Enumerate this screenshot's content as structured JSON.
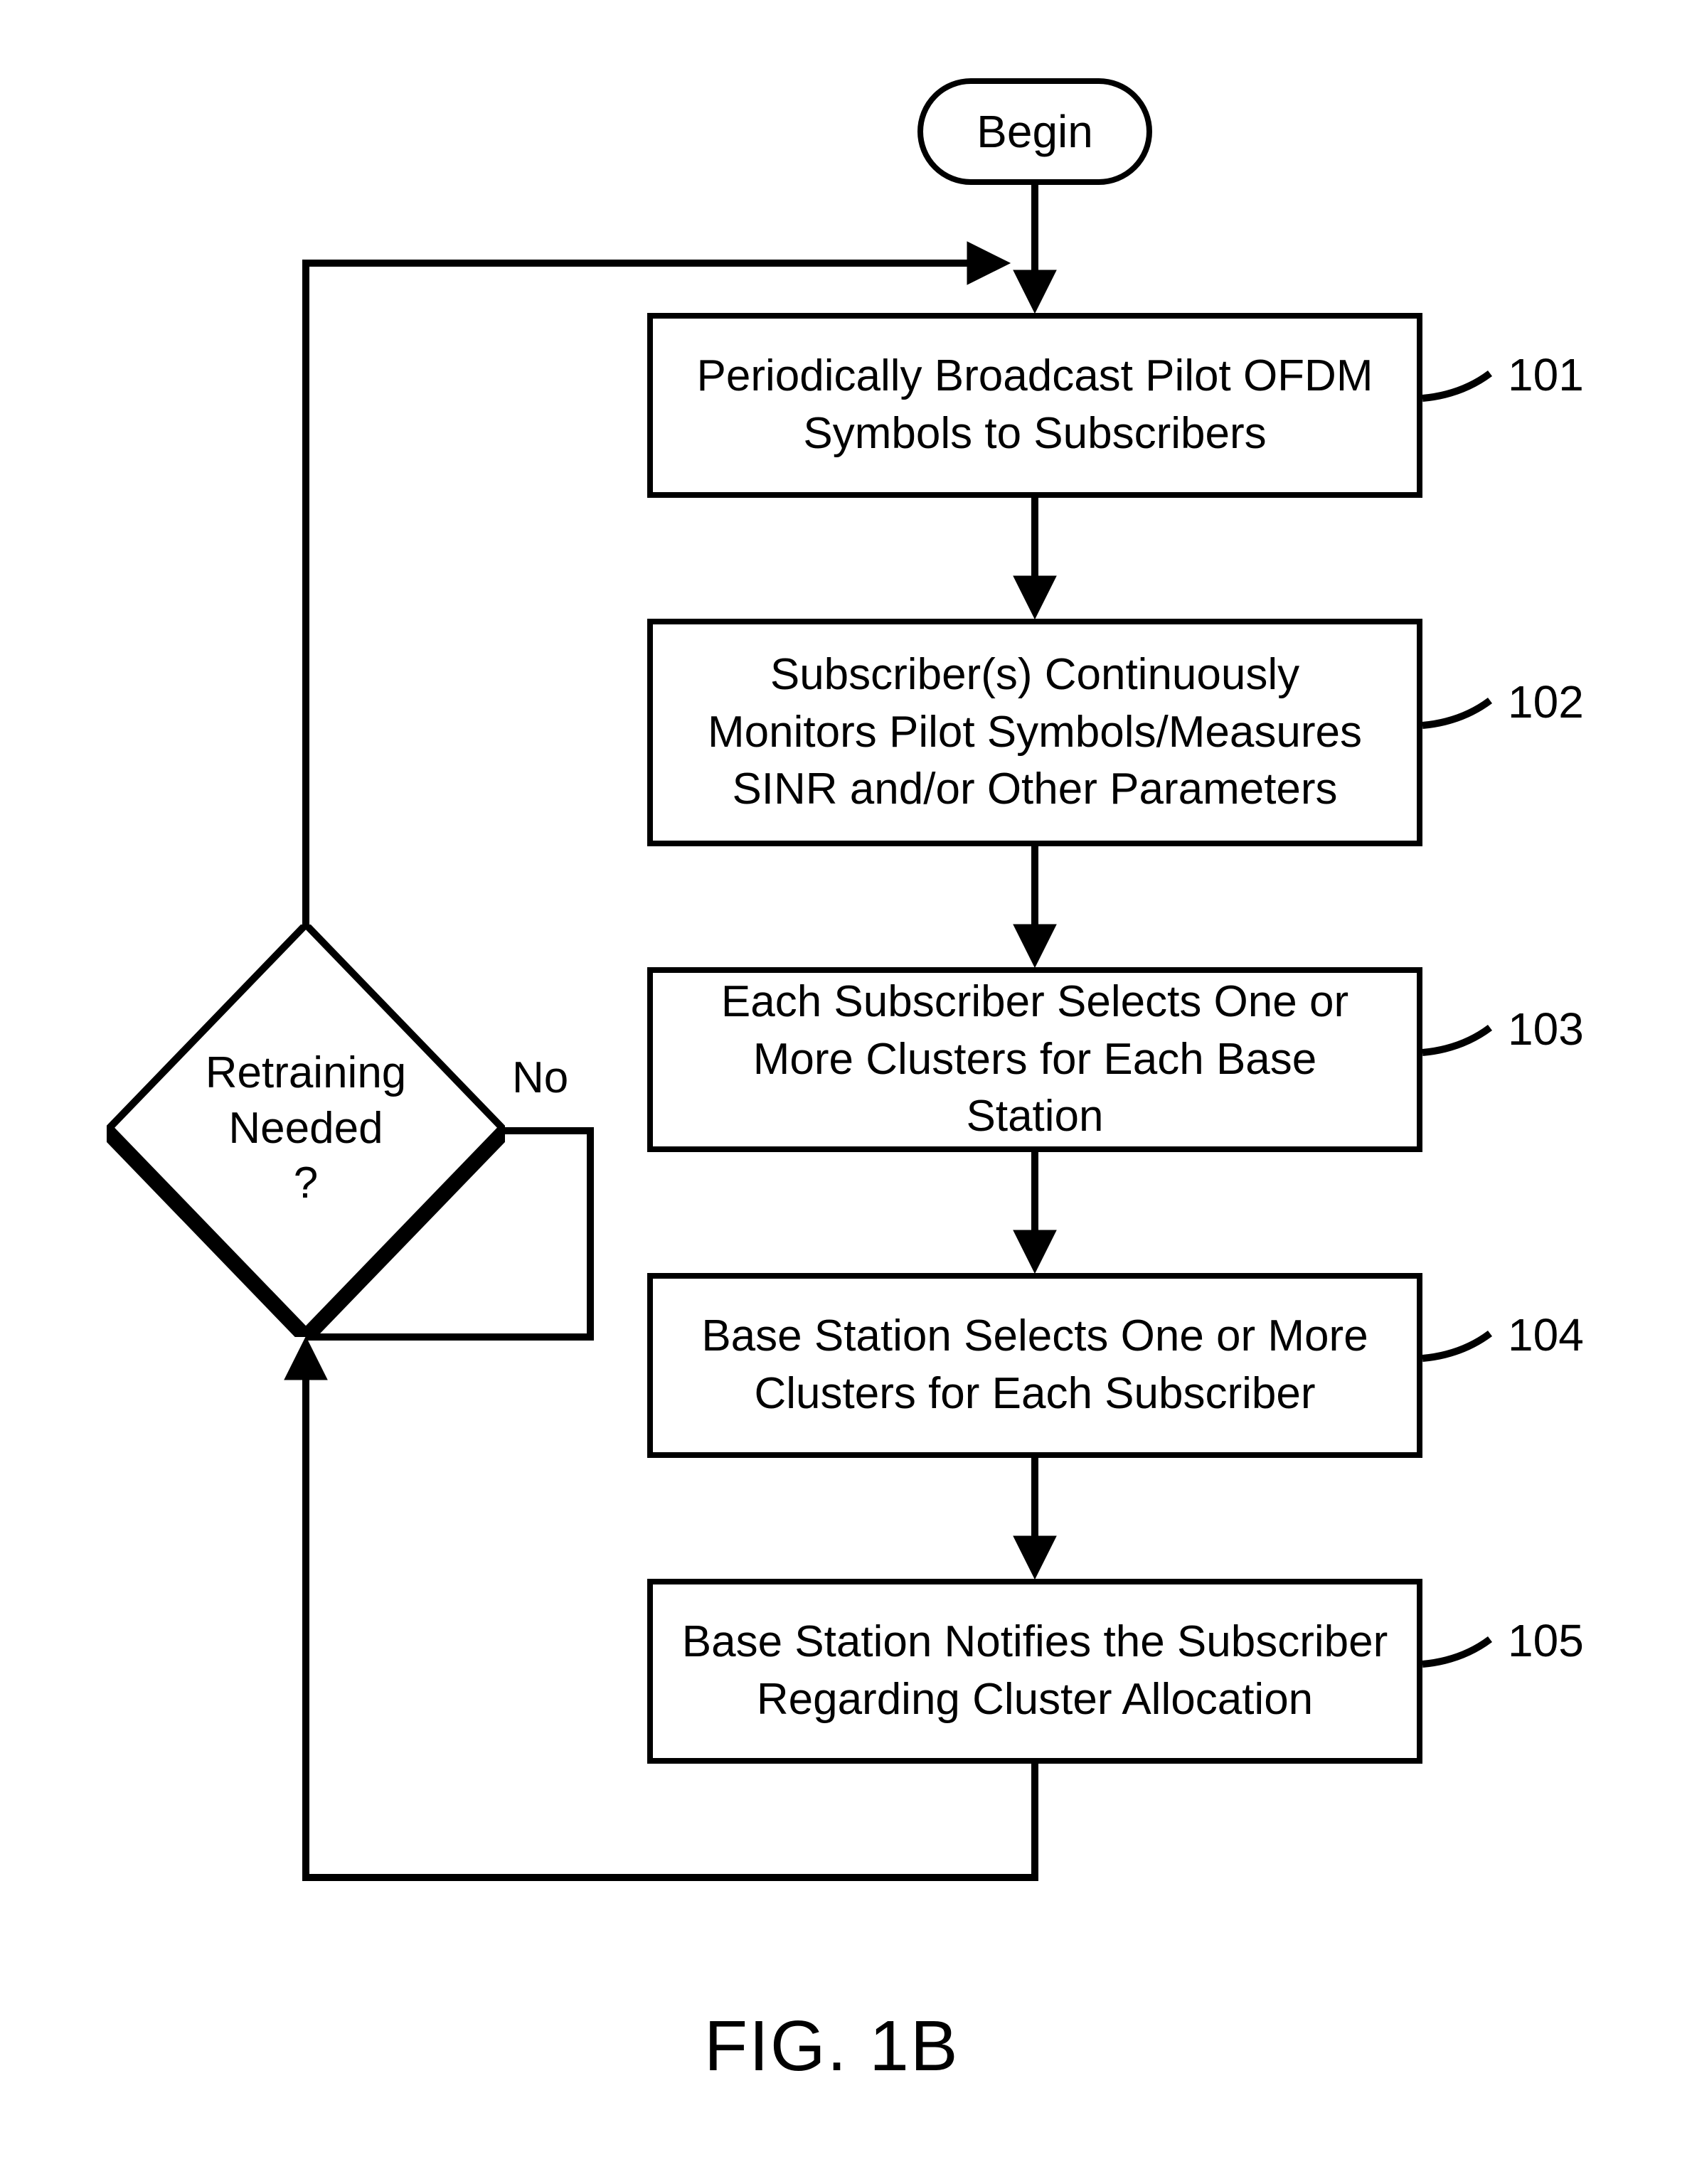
{
  "terminator": {
    "begin": "Begin"
  },
  "steps": {
    "s101": {
      "text": "Periodically Broadcast Pilot OFDM Symbols to Subscribers",
      "ref": "101"
    },
    "s102": {
      "text": "Subscriber(s) Continuously Monitors Pilot Symbols/Measures SINR and/or Other Parameters",
      "ref": "102"
    },
    "s103": {
      "text": "Each Subscriber Selects One or More Clusters for Each Base Station",
      "ref": "103"
    },
    "s104": {
      "text": "Base Station Selects One or More Clusters for Each Subscriber",
      "ref": "104"
    },
    "s105": {
      "text": "Base Station Notifies the Subscriber Regarding Cluster Allocation",
      "ref": "105"
    }
  },
  "decision": {
    "line1": "Retraining",
    "line2": "Needed",
    "line3": "?",
    "no": "No"
  },
  "figure": {
    "label": "FIG. 1B"
  }
}
